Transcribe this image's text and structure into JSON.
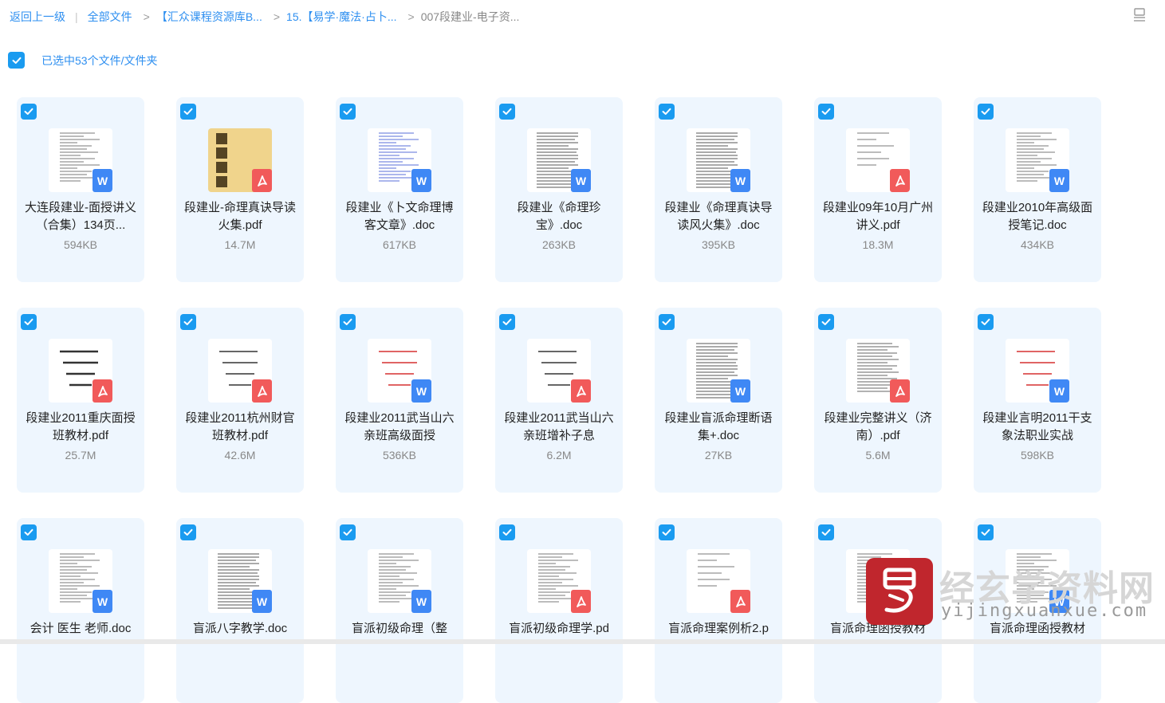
{
  "breadcrumb": {
    "back": "返回上一级",
    "all_files": "全部文件",
    "folder1": "【汇众课程资源库B...",
    "folder2": "15.【易学·魔法·占卜...",
    "current": "007段建业-电子资..."
  },
  "selection": {
    "label": "已选中53个文件/文件夹",
    "checked": true
  },
  "files": [
    {
      "name": "大连段建业-面授讲义（合集）134页...",
      "size": "594KB",
      "type": "doc",
      "thumb": "text"
    },
    {
      "name": "段建业-命理真诀导读火集.pdf",
      "size": "14.7M",
      "type": "pdf",
      "thumb": "book"
    },
    {
      "name": "段建业《卜文命理博客文章》.doc",
      "size": "617KB",
      "type": "doc",
      "thumb": "text-blue"
    },
    {
      "name": "段建业《命理珍宝》.doc",
      "size": "263KB",
      "type": "doc",
      "thumb": "text-dense"
    },
    {
      "name": "段建业《命理真诀导读风火集》.doc",
      "size": "395KB",
      "type": "doc",
      "thumb": "text-dense"
    },
    {
      "name": "段建业09年10月广州讲义.pdf",
      "size": "18.3M",
      "type": "pdf",
      "thumb": "text-sparse"
    },
    {
      "name": "段建业2010年高级面授笔记.doc",
      "size": "434KB",
      "type": "doc",
      "thumb": "text"
    },
    {
      "name": "段建业2011重庆面授班教材.pdf",
      "size": "25.7M",
      "type": "pdf",
      "thumb": "cover"
    },
    {
      "name": "段建业2011杭州财官班教材.pdf",
      "size": "42.6M",
      "type": "pdf",
      "thumb": "cover-light"
    },
    {
      "name": "段建业2011武当山六亲班高级面授",
      "size": "536KB",
      "type": "doc",
      "thumb": "cover-red"
    },
    {
      "name": "段建业2011武当山六亲班增补子息",
      "size": "6.2M",
      "type": "pdf",
      "thumb": "cover-light"
    },
    {
      "name": "段建业盲派命理断语集+.doc",
      "size": "27KB",
      "type": "doc",
      "thumb": "text-dense"
    },
    {
      "name": "段建业完整讲义（济南）.pdf",
      "size": "5.6M",
      "type": "pdf",
      "thumb": "scan"
    },
    {
      "name": "段建业言明2011干支象法职业实战",
      "size": "598KB",
      "type": "doc",
      "thumb": "cover-red"
    },
    {
      "name": "会计 医生 老师.doc",
      "size": "",
      "type": "doc",
      "thumb": "text"
    },
    {
      "name": "盲派八字教学.doc",
      "size": "",
      "type": "doc",
      "thumb": "text-dense"
    },
    {
      "name": "盲派初级命理（整",
      "size": "",
      "type": "doc",
      "thumb": "text"
    },
    {
      "name": "盲派初级命理学.pd",
      "size": "",
      "type": "pdf",
      "thumb": "text"
    },
    {
      "name": "盲派命理案例析2.p",
      "size": "",
      "type": "pdf",
      "thumb": "text-sparse"
    },
    {
      "name": "盲派命理函授教材",
      "size": "",
      "type": "pdf",
      "thumb": "text"
    },
    {
      "name": "盲派命理函授教材",
      "size": "",
      "type": "doc",
      "thumb": "text"
    }
  ],
  "icons": {
    "checkbox": "check-icon",
    "doc_badge": "W",
    "pdf_badge": "pdf-icon",
    "view_toggle": "list-view-icon"
  },
  "watermark": {
    "title": "经玄学资料网",
    "url": "yijingxuanxue.com"
  },
  "colors": {
    "accent": "#2e8ff0",
    "checkbox": "#1a9bf0",
    "card_bg": "#eef6fe",
    "doc_badge": "#3f88f5",
    "pdf_badge": "#f15a5a"
  }
}
